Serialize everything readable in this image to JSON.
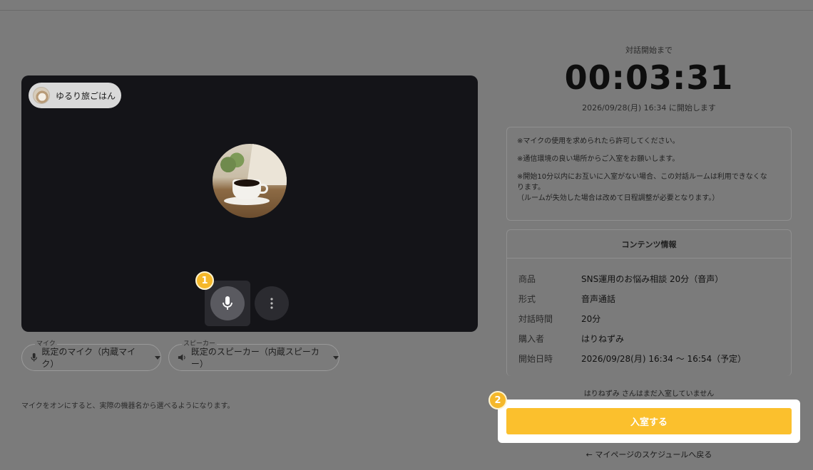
{
  "video": {
    "participant_name": "ゆるり旅ごはん",
    "mic_icon": "microphone-icon",
    "more_icon": "more-vertical-icon"
  },
  "steps": {
    "step1": "1",
    "step2": "2"
  },
  "devices": {
    "mic": {
      "legend": "マイク",
      "value": "既定のマイク（内蔵マイク）",
      "icon": "microphone-icon"
    },
    "speaker": {
      "legend": "スピーカー",
      "value": "既定のスピーカー（内蔵スピーカー）",
      "icon": "speaker-icon"
    },
    "hint": "マイクをオンにすると、実際の機器名から選べるようになります。"
  },
  "countdown": {
    "label": "対話開始まで",
    "time": "00:03:31",
    "start_text": "2026/09/28(月) 16:34 に開始します"
  },
  "notices": {
    "line1": "※マイクの使用を求められたら許可してください。",
    "line2": "※通信環境の良い場所からご入室をお願いします。",
    "line3a": "※開始10分以内にお互いに入室がない場合、この対話ルームは利用できなくな",
    "line3b": "ります。",
    "line4": "（ルームが失効した場合は改めて日程調整が必要となります。）"
  },
  "content_info": {
    "title": "コンテンツ情報",
    "rows": [
      {
        "key": "商品",
        "value": "SNS運用のお悩み相談 20分（音声）"
      },
      {
        "key": "形式",
        "value": "音声通話"
      },
      {
        "key": "対話時間",
        "value": "20分"
      },
      {
        "key": "購入者",
        "value": "はりねずみ"
      },
      {
        "key": "開始日時",
        "value": "2026/09/28(月) 16:34 〜 16:54（予定）"
      }
    ]
  },
  "waiting_text": "はりねずみ さんはまだ入室していません",
  "enter_button": "入室する",
  "back_link": "← マイページのスケジュールへ戻る",
  "colors": {
    "accent": "#fbc02d",
    "overlay": "#7b7b7b",
    "video_bg": "#141418"
  }
}
